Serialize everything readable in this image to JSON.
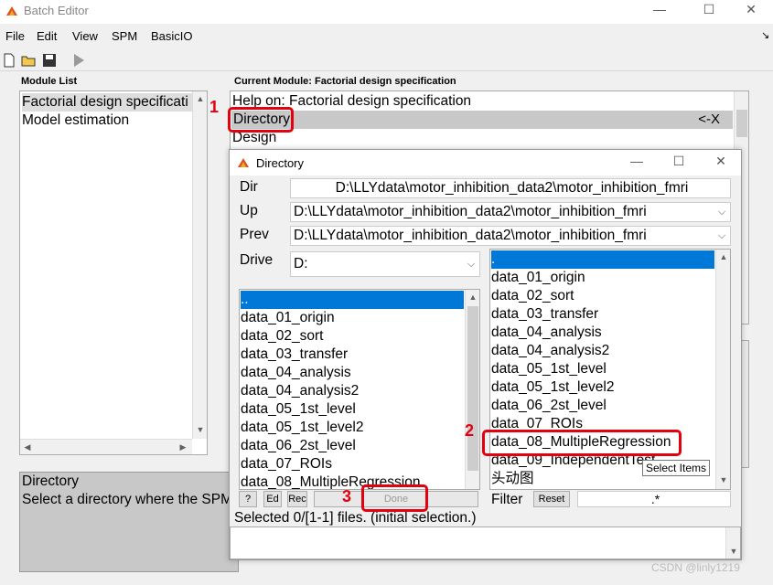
{
  "window": {
    "title": "Batch Editor"
  },
  "menu": [
    "File",
    "Edit",
    "View",
    "SPM",
    "BasicIO"
  ],
  "module_list": {
    "label": "Module List",
    "items": [
      "Factorial design specificati",
      "Model estimation"
    ]
  },
  "current_module": {
    "label": "Current Module: Factorial design specification",
    "rows": [
      {
        "text": "Help on: Factorial design specification",
        "right": ""
      },
      {
        "text": "Directory",
        "right": "<-X"
      },
      {
        "text": "Design",
        "right": ""
      }
    ]
  },
  "help_panel": {
    "title": "Directory",
    "text": "Select a directory where the SPM"
  },
  "dialog": {
    "title": "Directory",
    "dir_label": "Dir",
    "dir_value": "D:\\LLYdata\\motor_inhibition_data2\\motor_inhibition_fmri",
    "up_label": "Up",
    "up_value": "D:\\LLYdata\\motor_inhibition_data2\\motor_inhibition_fmri",
    "prev_label": "Prev",
    "prev_value": "D:\\LLYdata\\motor_inhibition_data2\\motor_inhibition_fmri",
    "drive_label": "Drive",
    "drive_value": "D:",
    "left_list": [
      "..",
      "data_01_origin",
      "data_02_sort",
      "data_03_transfer",
      "data_04_analysis",
      "data_04_analysis2",
      "data_05_1st_level",
      "data_05_1st_level2",
      "data_06_2st_level",
      "data_07_ROIs",
      "data_08_MultipleRegression"
    ],
    "right_list": [
      ".",
      "data_01_origin",
      "data_02_sort",
      "data_03_transfer",
      "data_04_analysis",
      "data_04_analysis2",
      "data_05_1st_level",
      "data_05_1st_level2",
      "data_06_2st_level",
      "data_07_ROIs",
      "data_08_MultipleRegression",
      "data_09_IndependentTest",
      "头动图"
    ],
    "buttons": {
      "help": "?",
      "ed": "Ed",
      "rec": "Rec",
      "done": "Done",
      "reset": "Reset"
    },
    "filter_label": "Filter",
    "filter_value": ".*",
    "status": "Selected 0/[1-1] files. (initial selection.)",
    "tooltip": "Select Items"
  },
  "annotations": {
    "n1": "1",
    "n2": "2",
    "n3": "3"
  },
  "watermark": "CSDN @linly1219"
}
